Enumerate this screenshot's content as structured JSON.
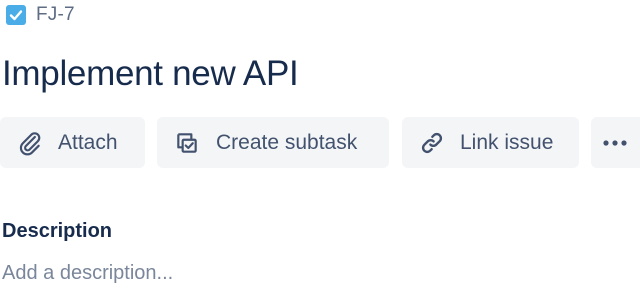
{
  "issue": {
    "type_icon": "checkbox-task-icon",
    "key": "FJ-7",
    "title": "Implement new API"
  },
  "toolbar": {
    "attach": {
      "label": "Attach",
      "icon": "paperclip-icon"
    },
    "create_subtask": {
      "label": "Create subtask",
      "icon": "subtask-icon"
    },
    "link_issue": {
      "label": "Link issue",
      "icon": "link-icon"
    },
    "more": {
      "icon": "more-horizontal-icon"
    }
  },
  "description": {
    "label": "Description",
    "placeholder": "Add a description..."
  },
  "colors": {
    "task_icon": "#4bade8",
    "text_primary": "#172b4d",
    "text_secondary": "#5e6c84",
    "button_bg": "#f4f5f7",
    "placeholder": "#7a869a"
  }
}
